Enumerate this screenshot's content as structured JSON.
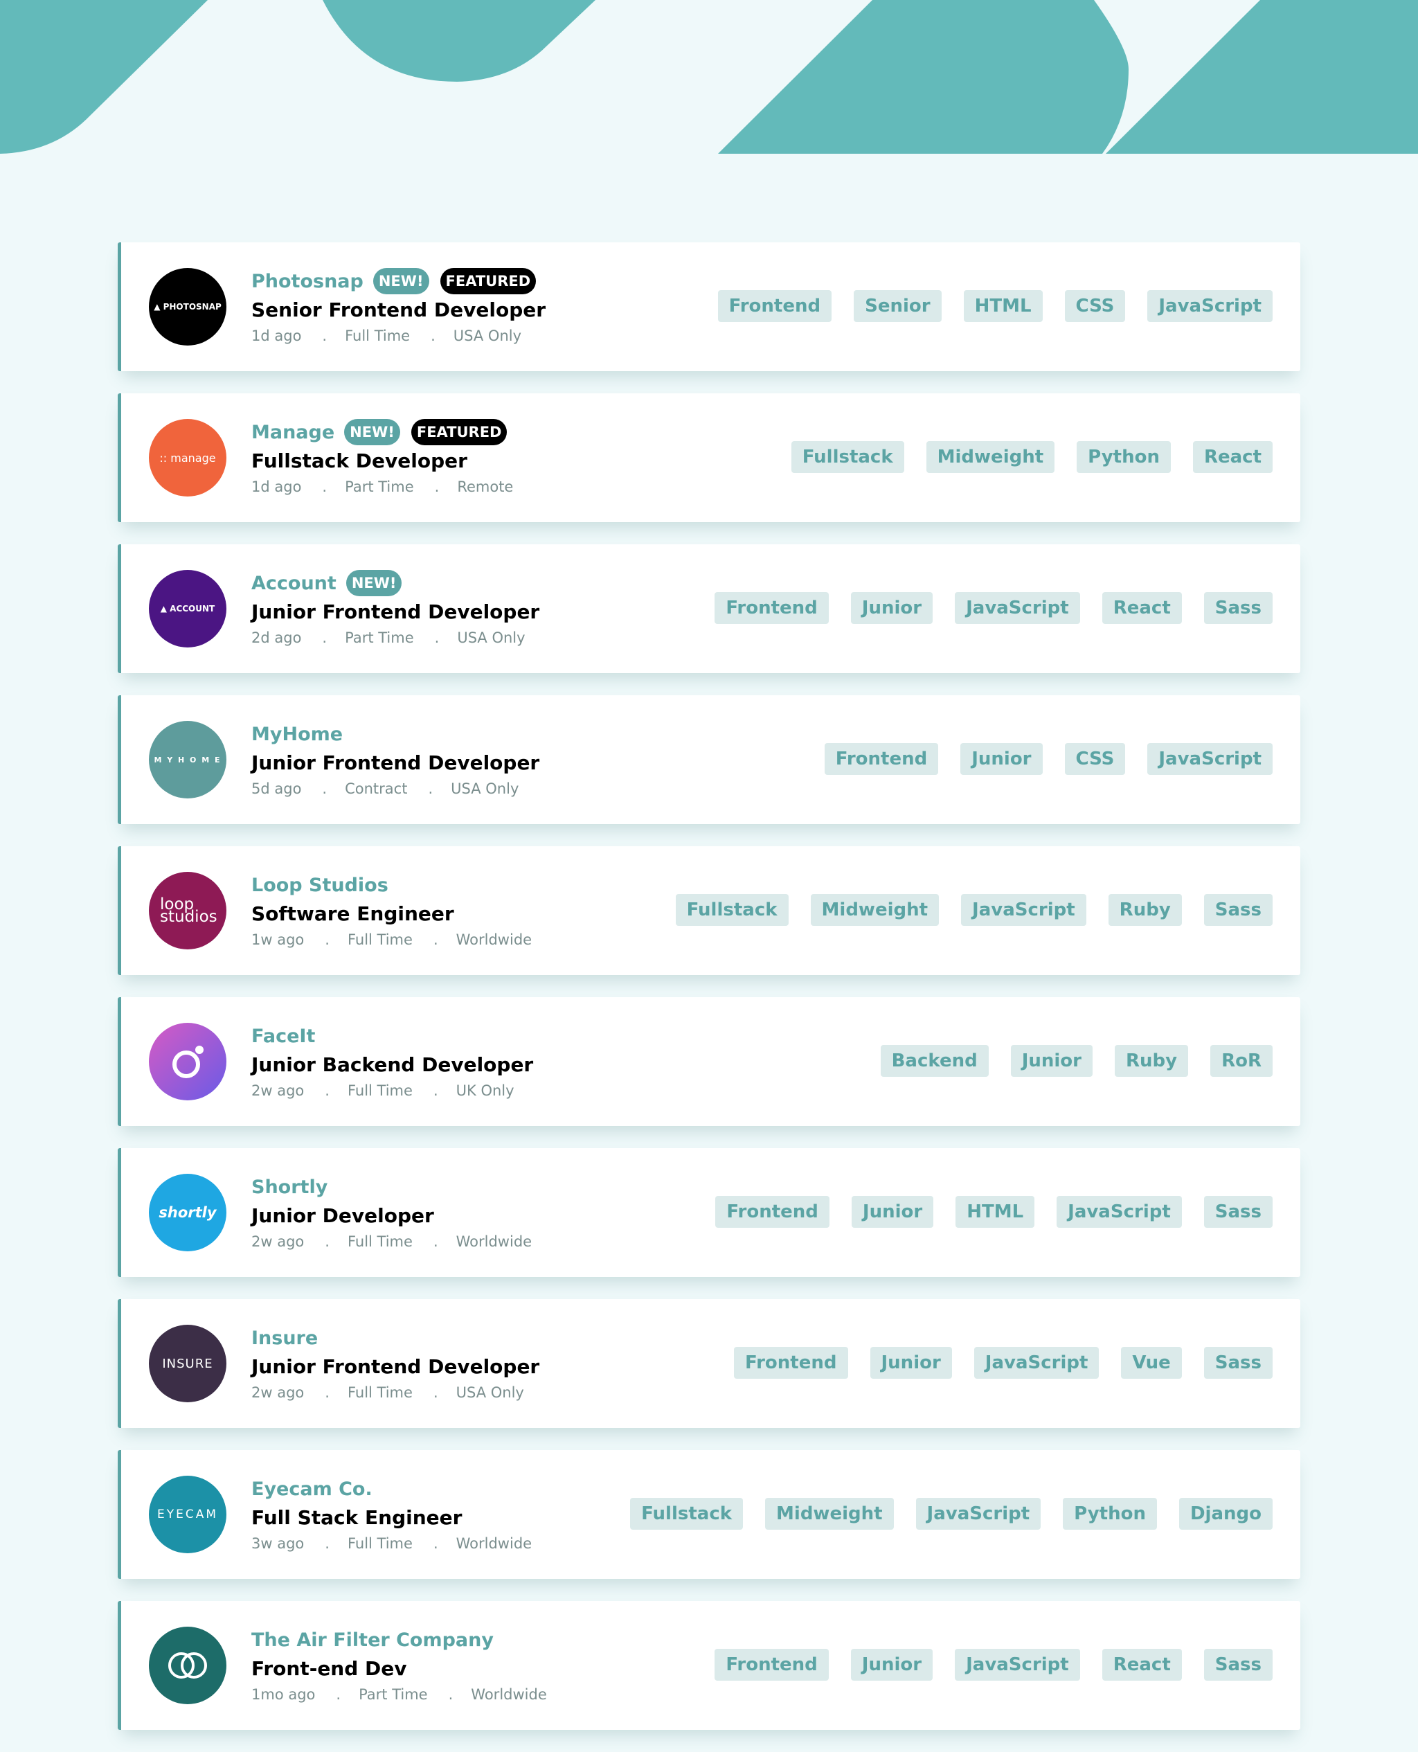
{
  "colors": {
    "primary": "#5ba4a4",
    "background": "#eff9fa",
    "tag_background": "#dbeaea",
    "header": "#63baba",
    "meta_text": "#7b8e8e"
  },
  "jobs": [
    {
      "company": "Photosnap",
      "new": "NEW!",
      "featured": "FEATURED",
      "position": "Senior Frontend Developer",
      "posted": "1d ago",
      "contract": "Full Time",
      "location": "USA Only",
      "tags": [
        "Frontend",
        "Senior",
        "HTML",
        "CSS",
        "JavaScript"
      ],
      "logo_text": "▲ PHOTOSNAP",
      "logo_color": "#000000"
    },
    {
      "company": "Manage",
      "new": "NEW!",
      "featured": "FEATURED",
      "position": "Fullstack Developer",
      "posted": "1d ago",
      "contract": "Part Time",
      "location": "Remote",
      "tags": [
        "Fullstack",
        "Midweight",
        "Python",
        "React"
      ],
      "logo_text": ":: manage",
      "logo_color": "#f0643c"
    },
    {
      "company": "Account",
      "new": "NEW!",
      "featured": "",
      "position": "Junior Frontend Developer",
      "posted": "2d ago",
      "contract": "Part Time",
      "location": "USA Only",
      "tags": [
        "Frontend",
        "Junior",
        "JavaScript",
        "React",
        "Sass"
      ],
      "logo_text": "▲ ACCOUNT",
      "logo_color": "#4b1583"
    },
    {
      "company": "MyHome",
      "new": "",
      "featured": "",
      "position": "Junior Frontend Developer",
      "posted": "5d ago",
      "contract": "Contract",
      "location": "USA Only",
      "tags": [
        "Frontend",
        "Junior",
        "CSS",
        "JavaScript"
      ],
      "logo_text": "M Y H O M E",
      "logo_color": "#5e9c9c"
    },
    {
      "company": "Loop Studios",
      "new": "",
      "featured": "",
      "position": "Software Engineer",
      "posted": "1w ago",
      "contract": "Full Time",
      "location": "Worldwide",
      "tags": [
        "Fullstack",
        "Midweight",
        "JavaScript",
        "Ruby",
        "Sass"
      ],
      "logo_text": "loop studios",
      "logo_color": "#8e1a55"
    },
    {
      "company": "FaceIt",
      "new": "",
      "featured": "",
      "position": "Junior Backend Developer",
      "posted": "2w ago",
      "contract": "Full Time",
      "location": "UK Only",
      "tags": [
        "Backend",
        "Junior",
        "Ruby",
        "RoR"
      ],
      "logo_text": "",
      "logo_color": "#c559d3"
    },
    {
      "company": "Shortly",
      "new": "",
      "featured": "",
      "position": "Junior Developer",
      "posted": "2w ago",
      "contract": "Full Time",
      "location": "Worldwide",
      "tags": [
        "Frontend",
        "Junior",
        "HTML",
        "JavaScript",
        "Sass"
      ],
      "logo_text": "shortly",
      "logo_color": "#1fa7e2"
    },
    {
      "company": "Insure",
      "new": "",
      "featured": "",
      "position": "Junior Frontend Developer",
      "posted": "2w ago",
      "contract": "Full Time",
      "location": "USA Only",
      "tags": [
        "Frontend",
        "Junior",
        "JavaScript",
        "Vue",
        "Sass"
      ],
      "logo_text": "INSURE",
      "logo_color": "#3c2e47"
    },
    {
      "company": "Eyecam Co.",
      "new": "",
      "featured": "",
      "position": "Full Stack Engineer",
      "posted": "3w ago",
      "contract": "Full Time",
      "location": "Worldwide",
      "tags": [
        "Fullstack",
        "Midweight",
        "JavaScript",
        "Python",
        "Django"
      ],
      "logo_text": "EYECAM",
      "logo_color": "#1c91a7"
    },
    {
      "company": "The Air Filter Company",
      "new": "",
      "featured": "",
      "position": "Front-end Dev",
      "posted": "1mo ago",
      "contract": "Part Time",
      "location": "Worldwide",
      "tags": [
        "Frontend",
        "Junior",
        "JavaScript",
        "React",
        "Sass"
      ],
      "logo_text": "",
      "logo_color": "#1d6c69"
    }
  ]
}
